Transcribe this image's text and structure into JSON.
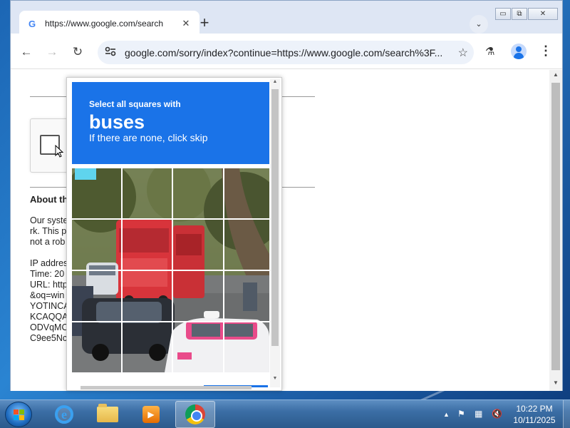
{
  "browser": {
    "tab_title": "https://www.google.com/search",
    "tab_close": "✕",
    "new_tab": "+",
    "tab_search": "⌄",
    "url": "google.com/sorry/index?continue=https://www.google.com/search%3F...",
    "window_controls": {
      "minimize": "▭",
      "restore": "⧉",
      "close": "✕"
    },
    "nav": {
      "back": "←",
      "forward": "→",
      "reload": "↻"
    },
    "icons": {
      "site_info": "site-info-icon",
      "star": "star-icon",
      "labs": "labs-icon",
      "profile": "profile-icon",
      "menu": "menu-icon"
    }
  },
  "page": {
    "about_title": "About th",
    "paragraph_lines": [
      "Our syste                                                     er netwo",
      "rk. This p                                                  ests, and",
      "not a rob"
    ],
    "ip_line": "IP addres",
    "time_line": "Time: 20",
    "url_lines": [
      "URL: http                                                 045+iso",
      "&oq=win                                                  ggAEEU",
      "YOTINCA                                                  BjvBTI",
      "KCAQQA                                                  IIBCDgy",
      "ODVqMC                                                  vraNGq",
      "C9ee5Nc"
    ]
  },
  "challenge": {
    "prompt": "Select all squares with",
    "target": "buses",
    "sub": "If there are none, click skip",
    "header_color": "#1a73e8"
  },
  "taskbar": {
    "time": "10:22 PM",
    "date": "10/11/2025",
    "apps": [
      "internet-explorer",
      "file-explorer",
      "media-player",
      "chrome"
    ],
    "tray": {
      "chevron": "▲",
      "flag": "⚑",
      "network": "▦",
      "volume": "🔇"
    }
  },
  "colors": {
    "accent": "#1a73e8",
    "taskbar": "#3b6ea5"
  }
}
